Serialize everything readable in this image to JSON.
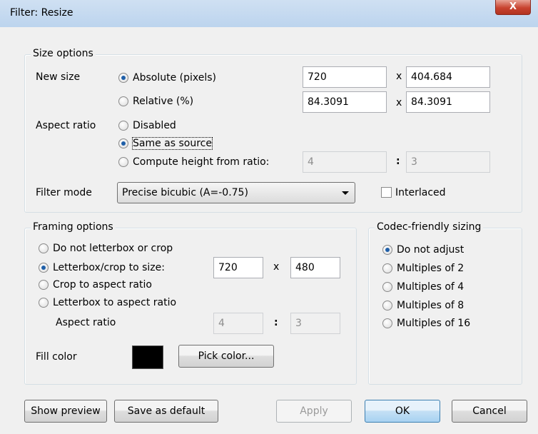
{
  "window": {
    "title": "Filter: Resize",
    "close_glyph": "X"
  },
  "size_options": {
    "legend": "Size options",
    "new_size_label": "New size",
    "absolute_label": "Absolute (pixels)",
    "relative_label": "Relative (%)",
    "absolute_width": "720",
    "absolute_height": "404.684",
    "relative_width": "84.3091",
    "relative_height": "84.3091",
    "x_sep": "x",
    "aspect_ratio_label": "Aspect ratio",
    "aspect_disabled_label": "Disabled",
    "aspect_same_label": "Same as source",
    "aspect_compute_label": "Compute height from ratio:",
    "ratio_num": "4",
    "ratio_den": "3",
    "colon_sep": ":",
    "filter_mode_label": "Filter mode",
    "filter_mode_value": "Precise bicubic (A=-0.75)",
    "interlaced_label": "Interlaced",
    "interlaced_checked": false,
    "new_size_selected": "absolute",
    "aspect_selected": "same"
  },
  "framing_options": {
    "legend": "Framing options",
    "no_letterbox_label": "Do not letterbox or crop",
    "letterbox_size_label": "Letterbox/crop to size:",
    "crop_aspect_label": "Crop to aspect ratio",
    "letterbox_aspect_label": "Letterbox to aspect ratio",
    "size_width": "720",
    "size_height": "480",
    "x_sep": "x",
    "aspect_ratio_label": "Aspect ratio",
    "ratio_num": "4",
    "ratio_den": "3",
    "colon_sep": ":",
    "fill_color_label": "Fill color",
    "fill_color": "#000000",
    "pick_color_label": "Pick color...",
    "selected": "letterbox_size"
  },
  "codec_sizing": {
    "legend": "Codec-friendly sizing",
    "options": [
      "Do not adjust",
      "Multiples of 2",
      "Multiples of 4",
      "Multiples of 8",
      "Multiples of 16"
    ],
    "selected_index": 0
  },
  "buttons": {
    "show_preview": "Show preview",
    "save_default": "Save as default",
    "apply": "Apply",
    "ok": "OK",
    "cancel": "Cancel"
  }
}
